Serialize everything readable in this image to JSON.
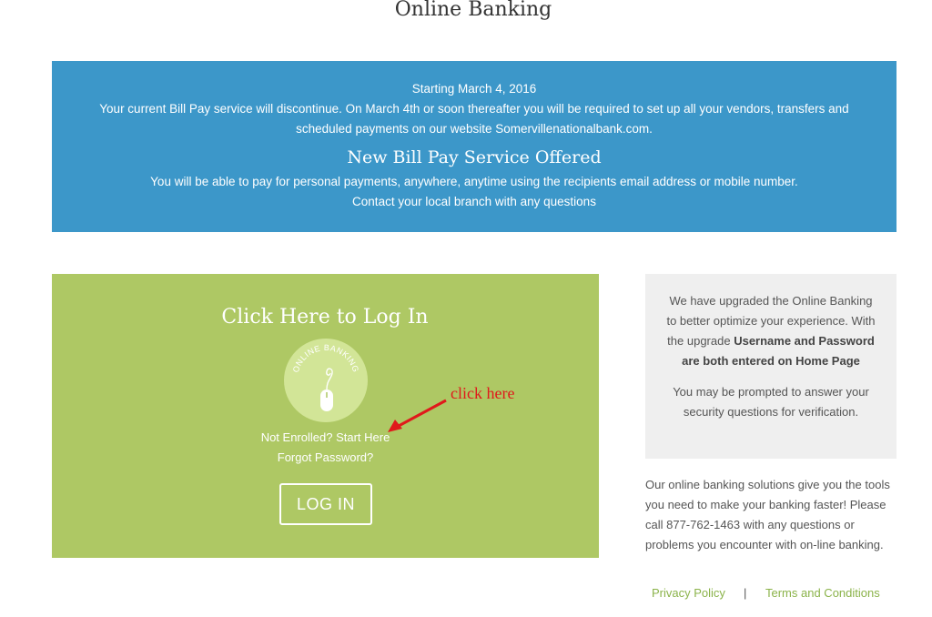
{
  "page": {
    "title": "Online Banking"
  },
  "notice": {
    "line1": "Starting March 4, 2016",
    "line2": "Your current Bill Pay service will discontinue. On March 4th or soon thereafter you will be required to set up all your vendors, transfers and",
    "line3": "scheduled payments on our website Somervillenationalbank.com.",
    "heading": "New Bill Pay Service Offered",
    "line4": "You will be able to pay for personal payments, anywhere, anytime using the recipients email address or mobile number.",
    "line5": "Contact your local branch with any questions",
    "background": "#3c97c9"
  },
  "login": {
    "title": "Click Here to Log In",
    "logo_text": "ONLINE BANKING",
    "logo_icon": "mouse-icon",
    "enroll_link": "Not Enrolled? Start Here",
    "forgot_link": "Forgot Password?",
    "button_label": "LOG IN",
    "background": "#aec864"
  },
  "annotation": {
    "text": "click here",
    "color": "#e0191b"
  },
  "upgrade_notice": {
    "text1": "We have upgraded the Online Banking to better optimize your experience. With the upgrade",
    "text_bold": "Username and Password are both entered on Home Page",
    "text2": "You may be prompted to answer your security questions for verification."
  },
  "info": {
    "text": "Our online banking solutions give you the tools you need to make your banking faster!  Please call 877-762-1463 with any questions or problems you encounter with on-line banking."
  },
  "footer": {
    "privacy": "Privacy Policy",
    "separator": "|",
    "terms": "Terms and Conditions",
    "link_color": "#8bb34a"
  }
}
